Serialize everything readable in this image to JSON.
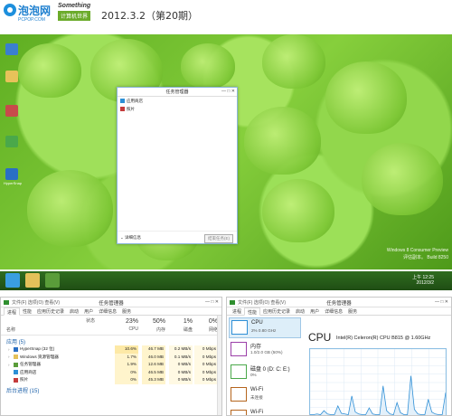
{
  "header": {
    "logo_cn": "泡泡网",
    "logo_url": "PCPOP.COM",
    "brand_top": "Something",
    "brand_bottom": "计算机世界",
    "issue": "2012.3.2（第20期）"
  },
  "desktop": {
    "icons": [
      {
        "label": "",
        "icon": "computer-icon",
        "color": "#3a7fd0"
      },
      {
        "label": "",
        "icon": "folder-icon",
        "color": "#e7c25a"
      },
      {
        "label": "",
        "icon": "document-icon",
        "color": "#c84b4b"
      },
      {
        "label": "",
        "icon": "app-icon",
        "color": "#4aa84a"
      },
      {
        "label": "HyperSnap",
        "icon": "hypersnap-icon",
        "color": "#2a6fc4"
      }
    ],
    "watermark_line1": "Windows 8 Consumer Preview",
    "watermark_line2": "评估副本。 Build 8250",
    "task_manager_small": {
      "title": "任务管理器",
      "apps": [
        {
          "name": "应用商店",
          "icon": "store-icon",
          "color": "#2c8fd6"
        },
        {
          "name": "照片",
          "icon": "photos-icon",
          "color": "#c43b3b"
        }
      ],
      "more_details": "详细信息",
      "end_task": "结束任务(E)"
    }
  },
  "taskbar": {
    "items": [
      {
        "icon": "ie-icon",
        "color": "#3a9ee0"
      },
      {
        "icon": "explorer-icon",
        "color": "#e4c15a"
      },
      {
        "icon": "taskmgr-icon",
        "color": "#5a9d3a"
      }
    ],
    "time": "上午 12:25",
    "date": "2012/3/2"
  },
  "processes_panel": {
    "menu": "文件(F) 选项(O) 查看(V)",
    "title": "任务管理器",
    "controls": "— □ ✕",
    "tabs": [
      "进程",
      "性能",
      "应用历史记录",
      "启动",
      "用户",
      "详细信息",
      "服务"
    ],
    "status_label": "状态",
    "name_label": "名称",
    "columns": [
      {
        "pct": "23%",
        "caption": "CPU"
      },
      {
        "pct": "50%",
        "caption": "内存"
      },
      {
        "pct": "1%",
        "caption": "磁盘"
      },
      {
        "pct": "0%",
        "caption": "网络"
      }
    ],
    "apps_group": "应用 (5)",
    "rows": [
      {
        "name": "HyperSnap (32 位)",
        "icon": "hypersnap-icon",
        "color": "#2a6fc4",
        "cpu": "10.6%",
        "mem": "46.7 MB",
        "disk": "0.2 MB/s",
        "net": "0 Mbps"
      },
      {
        "name": "Windows 资源管理器",
        "icon": "explorer-icon",
        "color": "#e4c15a",
        "cpu": "1.7%",
        "mem": "46.0 MB",
        "disk": "0.1 MB/s",
        "net": "0 Mbps"
      },
      {
        "name": "任务管理器",
        "icon": "taskmgr-icon",
        "color": "#5a9d3a",
        "cpu": "1.9%",
        "mem": "12.6 MB",
        "disk": "0 MB/s",
        "net": "0 Mbps"
      },
      {
        "name": "应用商店",
        "icon": "store-icon",
        "color": "#2c8fd6",
        "cpu": "0%",
        "mem": "46.5 MB",
        "disk": "0 MB/s",
        "net": "0 Mbps"
      },
      {
        "name": "照片",
        "icon": "photos-icon",
        "color": "#c43b3b",
        "cpu": "0%",
        "mem": "45.3 MB",
        "disk": "0 MB/s",
        "net": "0 Mbps"
      }
    ],
    "bg_group": "后台进程 (15)"
  },
  "perf_panel": {
    "menu": "文件(F) 选项(O) 查看(V)",
    "title": "任务管理器",
    "controls": "— □ ✕",
    "tabs": [
      "进程",
      "性能",
      "应用历史记录",
      "启动",
      "用户",
      "详细信息",
      "服务"
    ],
    "resources": [
      {
        "key": "CPU",
        "detail": "2% 0.80 GHz",
        "selected": true,
        "color": "#2f8fd6"
      },
      {
        "key": "内存",
        "detail": "1.0/2.0 GB (50%)",
        "selected": false,
        "color": "#9b3fa8"
      },
      {
        "key": "磁盘 0 (D: C: E:)",
        "detail": "0%",
        "selected": false,
        "color": "#4aa84a"
      },
      {
        "key": "Wi-Fi",
        "detail": "未连接",
        "selected": false,
        "color": "#b5651d"
      },
      {
        "key": "Wi-Fi",
        "detail": "",
        "selected": false,
        "color": "#b5651d"
      }
    ],
    "cpu_title": "CPU",
    "cpu_model": "Intel(R) Celeron(R) CPU B815 @ 1.60GHz",
    "chart_data": {
      "type": "line",
      "values": [
        2,
        2,
        3,
        2,
        8,
        3,
        2,
        2,
        15,
        4,
        3,
        2,
        30,
        6,
        3,
        2,
        2,
        12,
        3,
        2,
        2,
        45,
        8,
        3,
        2,
        20,
        5,
        2,
        2,
        60,
        10,
        3,
        2,
        2,
        25,
        6,
        3,
        2,
        2,
        35
      ]
    }
  }
}
